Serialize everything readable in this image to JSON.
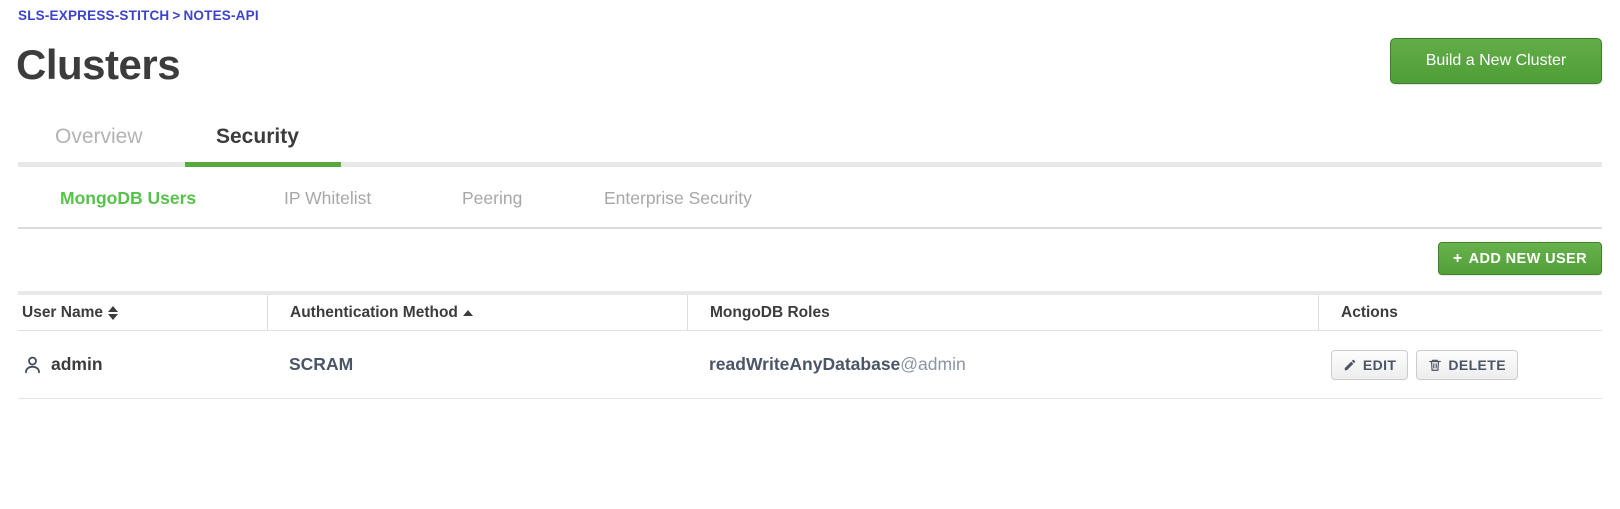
{
  "breadcrumb": {
    "items": [
      "SLS-EXPRESS-STITCH",
      "NOTES-API"
    ],
    "separator": ">",
    "color": "#3b43ce"
  },
  "header": {
    "title": "Clusters",
    "primary_button": {
      "label": "Build a New Cluster",
      "color": "#56a93c"
    }
  },
  "tabs": [
    {
      "label": "Overview",
      "active": false
    },
    {
      "label": "Security",
      "active": true
    }
  ],
  "subtabs": [
    {
      "label": "MongoDB Users",
      "active": true
    },
    {
      "label": "IP Whitelist",
      "active": false
    },
    {
      "label": "Peering",
      "active": false
    },
    {
      "label": "Enterprise Security",
      "active": false
    }
  ],
  "toolbar": {
    "add_user_label": "ADD NEW USER",
    "add_user_plus": "+"
  },
  "table": {
    "columns": [
      {
        "label": "User Name",
        "sort": "none"
      },
      {
        "label": "Authentication Method",
        "sort": "asc"
      },
      {
        "label": "MongoDB Roles",
        "sort": null
      },
      {
        "label": "Actions",
        "sort": null
      }
    ],
    "rows": [
      {
        "user_name": "admin",
        "auth_method": "SCRAM",
        "role_name": "readWriteAnyDatabase",
        "role_db": "@admin",
        "edit_label": "EDIT",
        "delete_label": "DELETE"
      }
    ]
  },
  "colors": {
    "accent_green": "#56a93c",
    "subtab_green": "#56c24a",
    "link_blue": "#3b43ce",
    "text_dark": "#3c3c3c",
    "text_muted": "#a7a7a7"
  }
}
